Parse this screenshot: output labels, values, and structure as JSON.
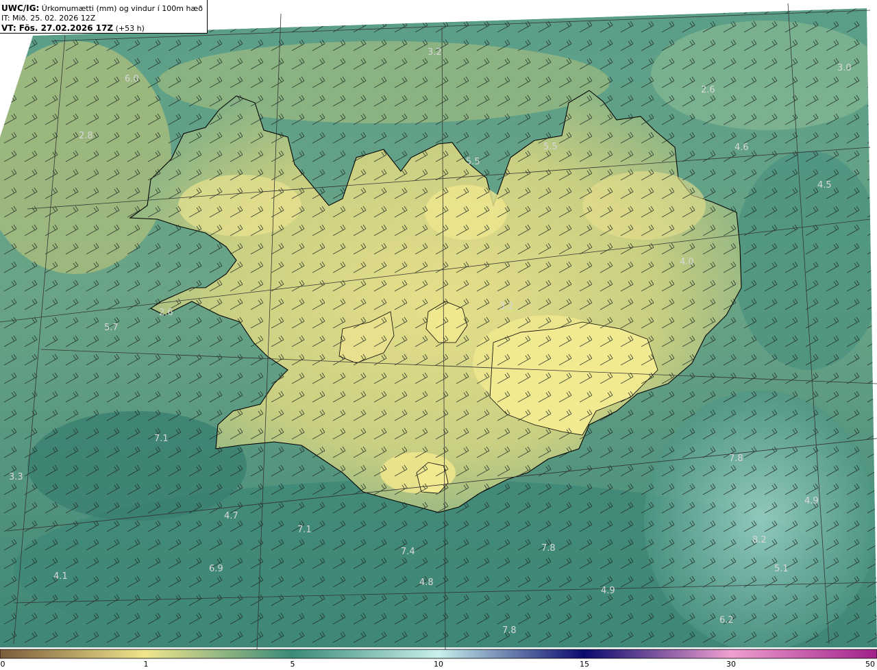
{
  "header": {
    "product": "UWC/IG:",
    "description": "Úrkomumætti (mm) og vindur í 100m hæð",
    "initial_time": "IT: Mið. 25. 02. 2026 12Z",
    "valid_label": "VT: Fös. 27.02.2026 17Z",
    "lead_time": "(+53 h)"
  },
  "colorbar": {
    "ticks": [
      "0",
      "1",
      "5",
      "10",
      "15",
      "30",
      "50"
    ],
    "colors": [
      "#7a5c3a",
      "#f0e68c",
      "#3a8a78",
      "#c8f0ec",
      "#0a0a6e",
      "#f0a0d0",
      "#a0208a"
    ]
  },
  "map": {
    "colors": {
      "dry": "#b9c87e",
      "mid": "#4f9584",
      "wet": "#2f7463",
      "high": "#f0e68c",
      "moist_sea": "#8fd0c4",
      "coast": "#000000",
      "grid": "#333333"
    },
    "value_labels": [
      {
        "text": "3.2"
      },
      {
        "text": "3.0"
      },
      {
        "text": "6.0"
      },
      {
        "text": "2.6"
      },
      {
        "text": "2.8"
      },
      {
        "text": "5.5"
      },
      {
        "text": "5.5"
      },
      {
        "text": "4.6"
      },
      {
        "text": "4.5"
      },
      {
        "text": "4.0"
      },
      {
        "text": "3.2"
      },
      {
        "text": "2.6"
      },
      {
        "text": "5.7"
      },
      {
        "text": "7.1"
      },
      {
        "text": "7.8"
      },
      {
        "text": "3.3"
      },
      {
        "text": "4.7"
      },
      {
        "text": "7.1"
      },
      {
        "text": "4.9"
      },
      {
        "text": "7.4"
      },
      {
        "text": "7.8"
      },
      {
        "text": "8.2"
      },
      {
        "text": "6.9"
      },
      {
        "text": "4.1"
      },
      {
        "text": "4.8"
      },
      {
        "text": "5.1"
      },
      {
        "text": "4.9"
      },
      {
        "text": "6.2"
      },
      {
        "text": "7.8"
      }
    ]
  }
}
